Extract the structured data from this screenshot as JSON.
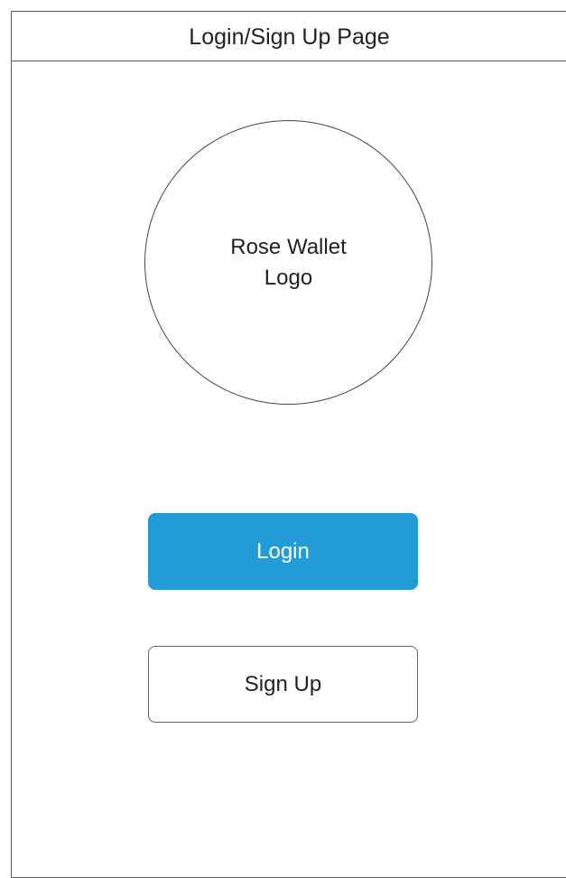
{
  "header": {
    "title": "Login/Sign Up Page"
  },
  "logo": {
    "text": "Rose Wallet Logo"
  },
  "actions": {
    "login_label": "Login",
    "signup_label": "Sign Up"
  },
  "colors": {
    "login_button_bg": "#239bd6",
    "border": "#5a5a5a"
  }
}
